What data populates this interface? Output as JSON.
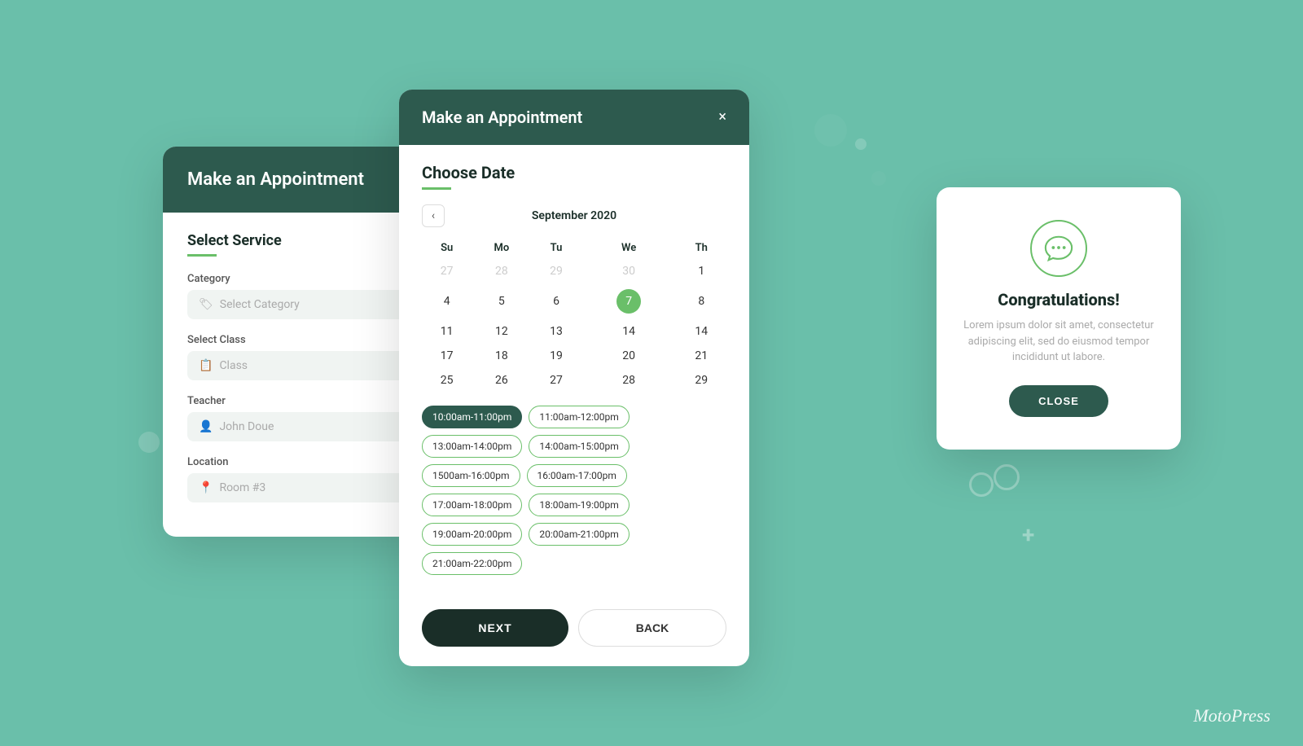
{
  "background": {
    "color": "#6abfaa"
  },
  "brand": "MotoPress",
  "card_back": {
    "header": "Make an Appointment",
    "section_title": "Select Service",
    "fields": [
      {
        "label": "Category",
        "placeholder": "Select Category",
        "icon": "🏷"
      },
      {
        "label": "Select Class",
        "placeholder": "Class",
        "icon": "📋"
      },
      {
        "label": "Teacher",
        "placeholder": "John Doue",
        "icon": "👤"
      },
      {
        "label": "Location",
        "placeholder": "Room #3",
        "icon": "📍"
      }
    ]
  },
  "card_mid": {
    "header": "Make an Appointment",
    "close_label": "×",
    "section_title": "Choose Date",
    "calendar": {
      "month": "September 2020",
      "days_of_week": [
        "Su",
        "Mo",
        "Tu",
        "We",
        "Th"
      ],
      "weeks": [
        [
          "27",
          "28",
          "29",
          "30",
          "1"
        ],
        [
          "4",
          "5",
          "6",
          "7",
          "8"
        ],
        [
          "11",
          "12",
          "13",
          "14",
          "14"
        ],
        [
          "17",
          "18",
          "19",
          "20",
          "21"
        ],
        [
          "25",
          "26",
          "27",
          "28",
          "29"
        ]
      ],
      "selected_day": "7"
    },
    "time_slots": [
      {
        "label": "10:00am-11:00pm",
        "active": true
      },
      {
        "label": "11:00am-12:00pm",
        "active": false
      },
      {
        "label": "13:00am-14:00pm",
        "active": false
      },
      {
        "label": "14:00am-15:00pm",
        "active": false
      },
      {
        "label": "1500am-16:00pm",
        "active": false
      },
      {
        "label": "16:00am-17:00pm",
        "active": false
      },
      {
        "label": "17:00am-18:00pm",
        "active": false
      },
      {
        "label": "18:00am-19:00pm",
        "active": false
      },
      {
        "label": "19:00am-20:00pm",
        "active": false
      },
      {
        "label": "20:00am-21:00pm",
        "active": false
      },
      {
        "label": "21:00am-22:00pm",
        "active": false
      }
    ],
    "btn_next": "NEXT",
    "btn_back": "BACK"
  },
  "card_front": {
    "congrats_title": "Congratulations!",
    "congrats_text": "Lorem ipsum dolor sit amet, consectetur adipiscing elit, sed do eiusmod tempor incididunt ut labore.",
    "close_button": "CLOSE"
  }
}
